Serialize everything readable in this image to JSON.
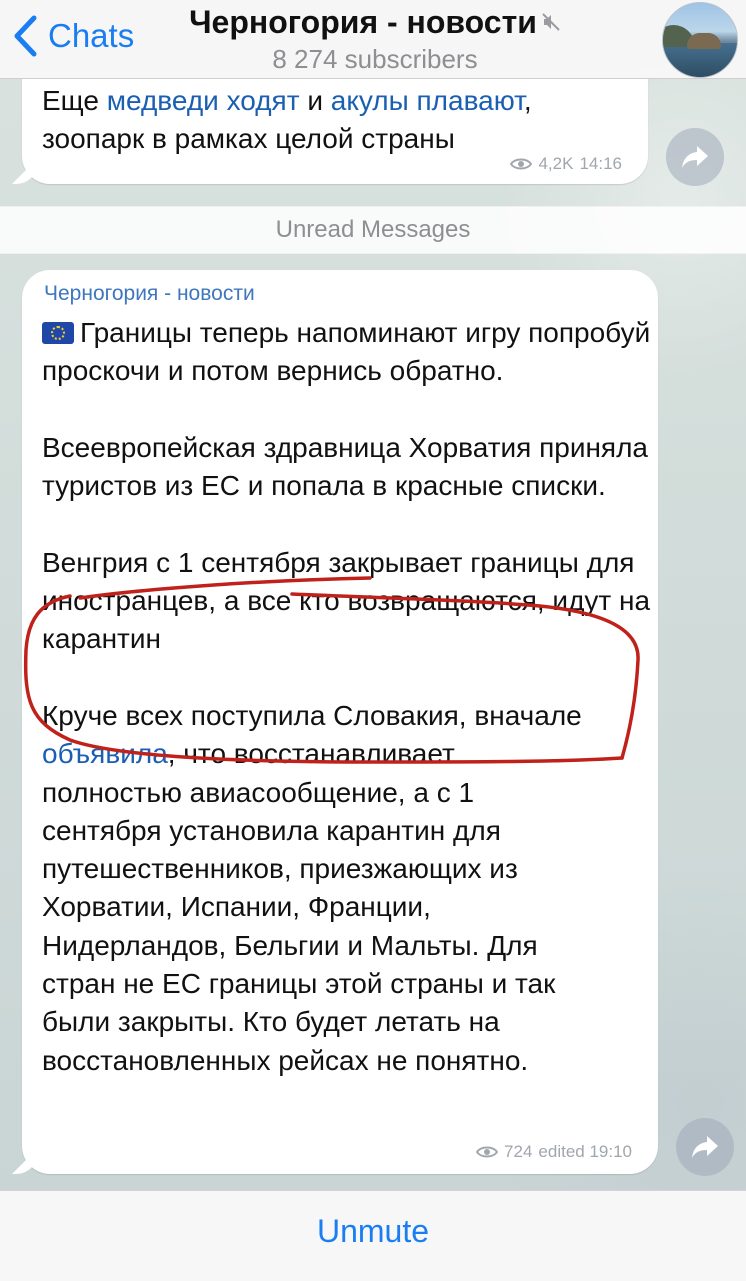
{
  "header": {
    "back_label": "Chats",
    "title": "Черногория - новости",
    "subtitle": "8 274 subscribers"
  },
  "messages": [
    {
      "text_parts": [
        "Еще ",
        "медведи ходят",
        " и ",
        "акулы плавают",
        ",",
        "зоопарк в рамках целой страны"
      ],
      "views": "4,2K",
      "time": "14:16"
    },
    {
      "author": "Черногория - новости",
      "paragraphs": [
        "Границы теперь напоминают игру попробуй проскочи и потом вернись обратно.",
        "Всеевропейская здравница Хорватия приняла туристов из ЕС и попала в красные списки.",
        "Венгрия с 1 сентября закрывает границы для иностранцев, а все кто возвращаются, идут на карантин"
      ],
      "para4_link": "объявила",
      "para4_lines": [
        "Круче всех поступила Словакия, вначале",
        ", что восстанавливает",
        "полностью авиасообщение, а с 1",
        "сентября установила карантин для",
        "путешественников, приезжающих из",
        "Хорватии, Испании, Франции,",
        "Нидерландов, Бельгии и Мальты. Для",
        "стран не ЕС границы этой страны и так",
        "были закрыты. Кто будет летать на",
        "восстановленных рейсах не понятно."
      ],
      "views": "724",
      "edited_time": "edited 19:10"
    }
  ],
  "separator": "Unread Messages",
  "bottom": {
    "action_label": "Unmute"
  },
  "colors": {
    "accent": "#1a7ef2",
    "link": "#1b5fb3",
    "annotation": "#c0221b"
  }
}
